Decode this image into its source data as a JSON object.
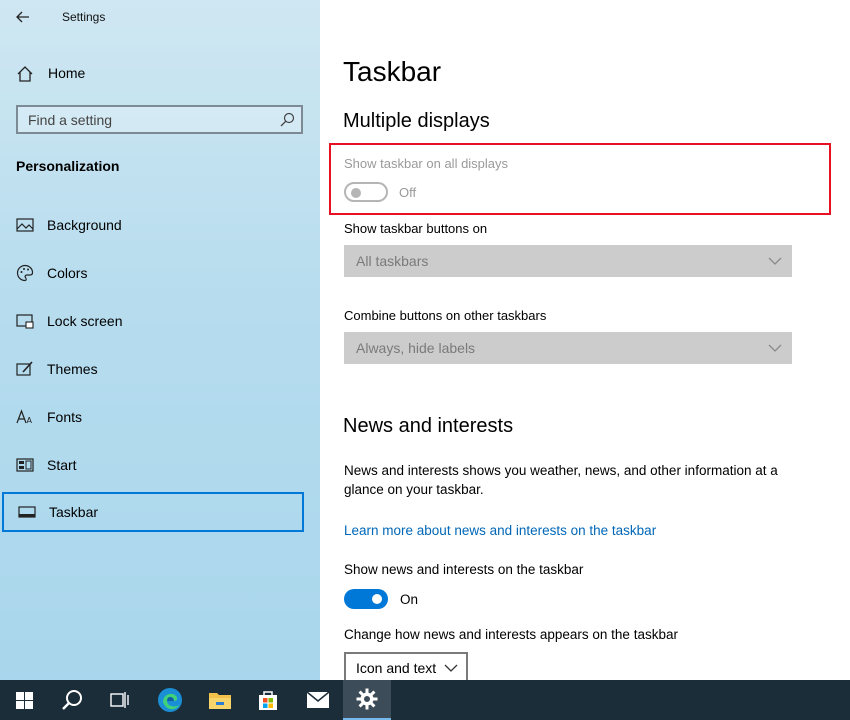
{
  "window": {
    "title": "Settings"
  },
  "sidebar": {
    "home_label": "Home",
    "search_placeholder": "Find a setting",
    "section_title": "Personalization",
    "items": [
      {
        "label": "Background",
        "icon": "background-icon"
      },
      {
        "label": "Colors",
        "icon": "palette-icon"
      },
      {
        "label": "Lock screen",
        "icon": "lock-screen-icon"
      },
      {
        "label": "Themes",
        "icon": "themes-icon"
      },
      {
        "label": "Fonts",
        "icon": "fonts-icon"
      },
      {
        "label": "Start",
        "icon": "start-icon"
      },
      {
        "label": "Taskbar",
        "icon": "taskbar-icon",
        "selected": true
      }
    ]
  },
  "main": {
    "page_title": "Taskbar",
    "multiple_displays": {
      "heading": "Multiple displays",
      "show_all_label": "Show taskbar on all displays",
      "show_all_state": "Off",
      "buttons_on_label": "Show taskbar buttons on",
      "buttons_on_value": "All taskbars",
      "combine_label": "Combine buttons on other taskbars",
      "combine_value": "Always, hide labels"
    },
    "news": {
      "heading": "News and interests",
      "description": "News and interests shows you weather, news, and other information at a glance on your taskbar.",
      "learn_more_link": "Learn more about news and interests on the taskbar",
      "show_label": "Show news and interests on the taskbar",
      "show_state": "On",
      "change_label": "Change how news and interests appears on the taskbar",
      "appearance_value": "Icon and text"
    }
  },
  "taskbar": {
    "items": [
      "windows-start-icon",
      "search-icon",
      "task-view-icon",
      "edge-icon",
      "file-explorer-icon",
      "store-icon",
      "mail-icon",
      "settings-gear-icon"
    ]
  },
  "colors": {
    "accent": "#0078d7",
    "highlight_box": "#e81123",
    "link": "#0067b8",
    "taskbar_bg": "#1c2d3a"
  }
}
